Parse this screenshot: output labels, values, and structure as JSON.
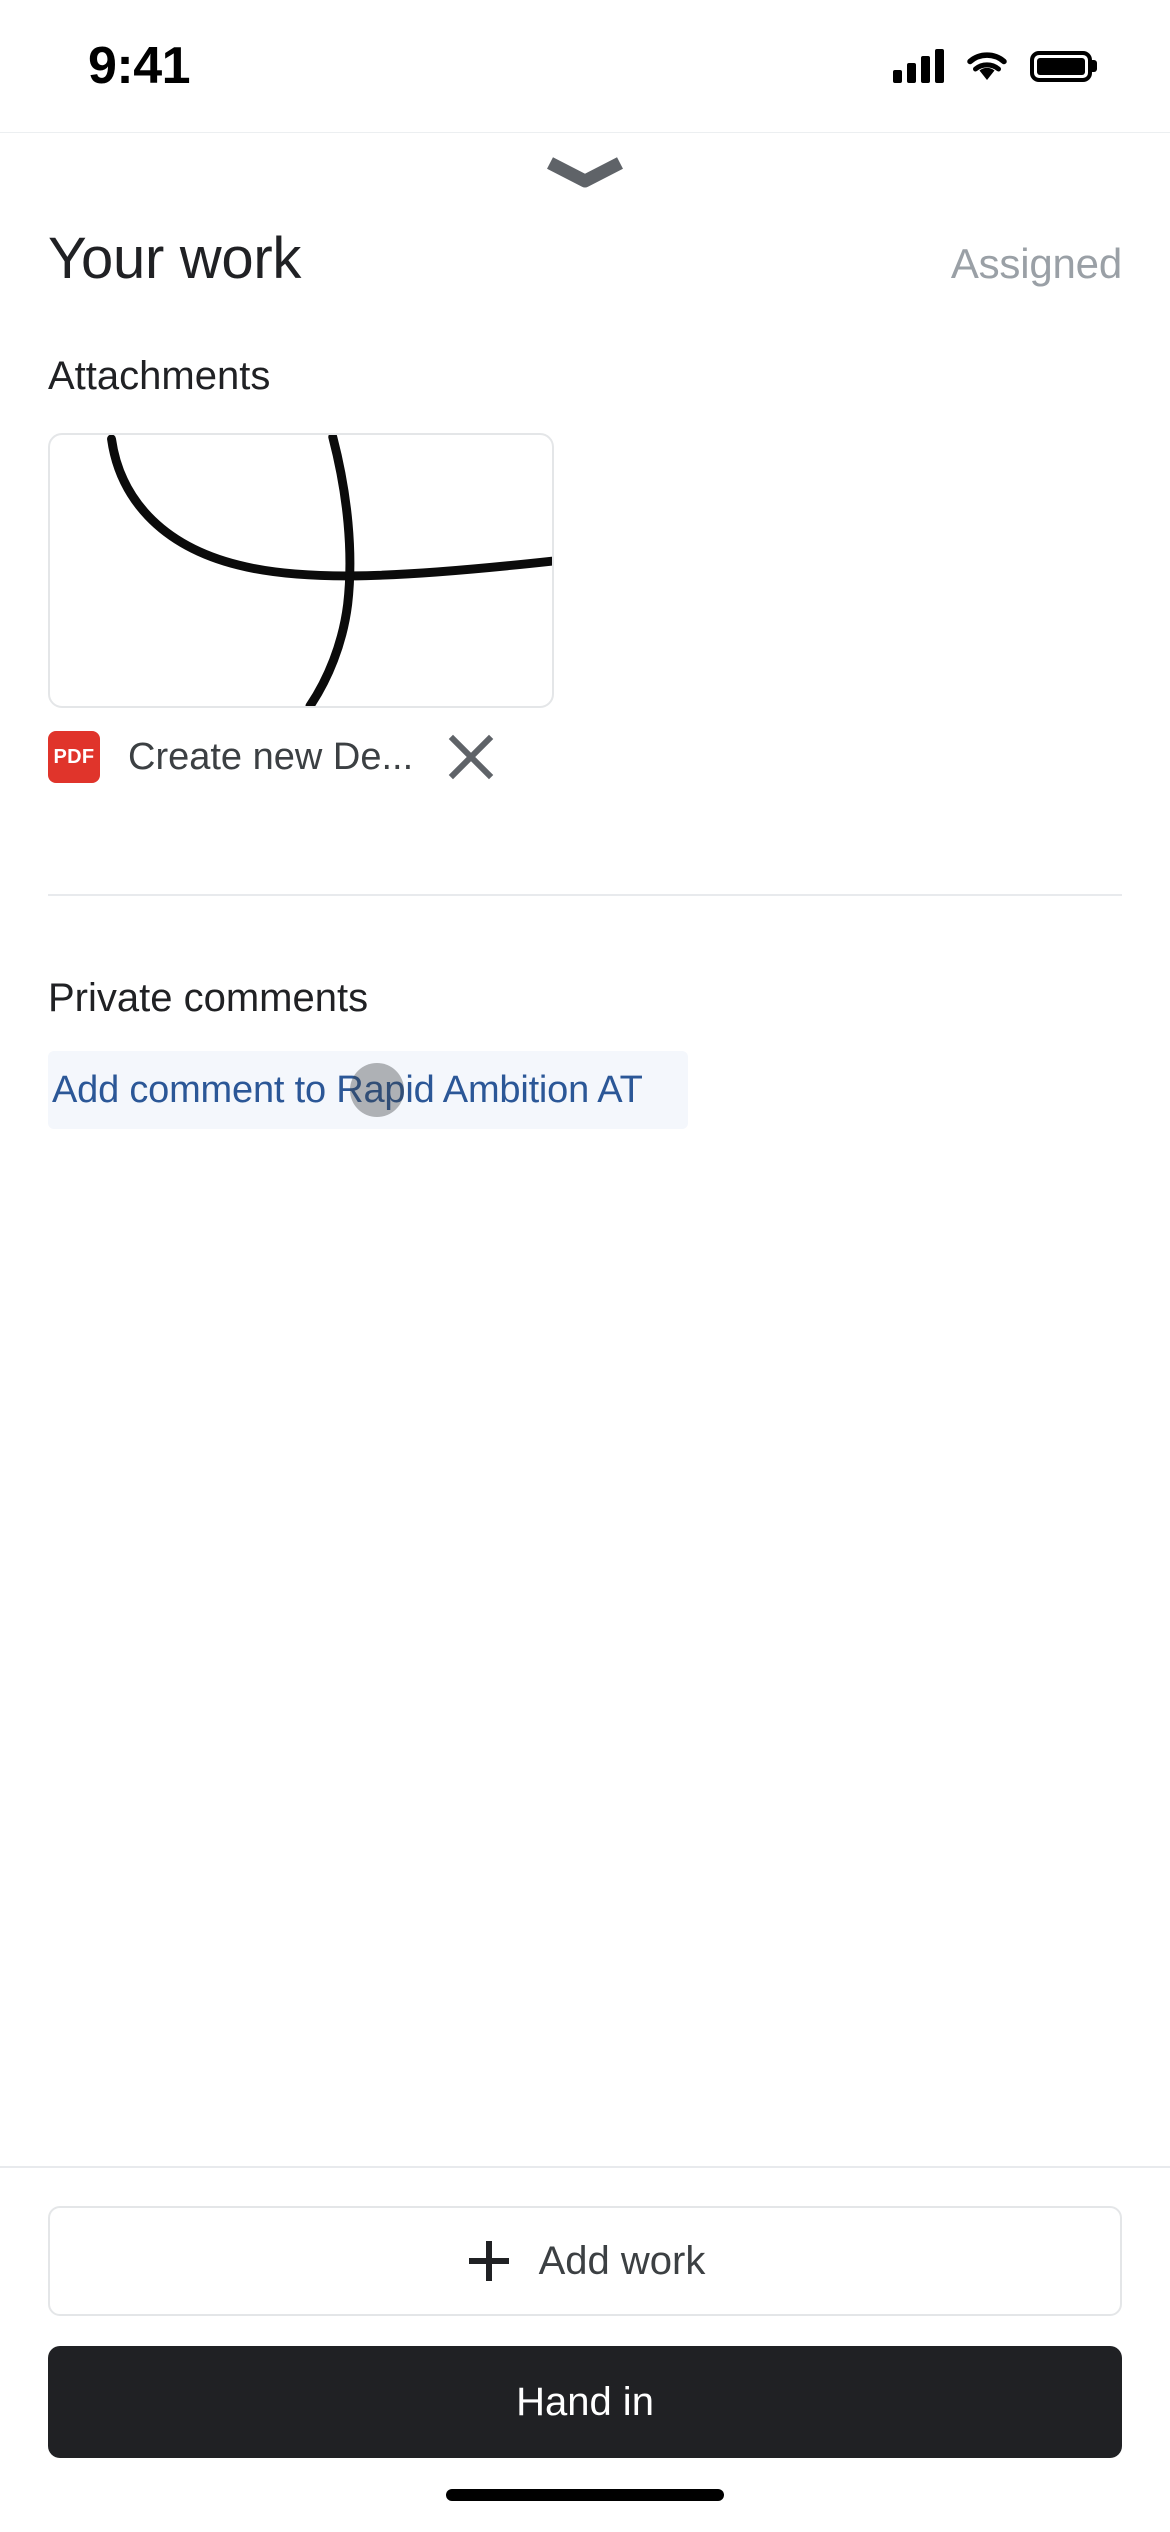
{
  "status_bar": {
    "time": "9:41",
    "signal_icon": "cellular-signal-icon",
    "wifi_icon": "wifi-icon",
    "battery_icon": "battery-full-icon"
  },
  "sheet": {
    "grabber_icon": "chevron-down-icon",
    "title": "Your work",
    "status": "Assigned"
  },
  "attachments": {
    "label": "Attachments",
    "items": [
      {
        "thumbnail_alt": "handwritten-sketch-thumbnail",
        "file_type_badge": "PDF",
        "file_name": "Create new De...",
        "remove_icon": "close-icon"
      }
    ]
  },
  "private_comments": {
    "label": "Private comments",
    "input_text": "Add comment to Rapid Ambition AT",
    "input_placeholder": "Add comment to Rapid Ambition AT",
    "touch_indicator": "touch-point-indicator"
  },
  "actions": {
    "add_work_icon": "plus-icon",
    "add_work_label": "Add work",
    "hand_in_label": "Hand in"
  },
  "colors": {
    "accent_blue": "#2b5797",
    "pdf_red": "#e0342b",
    "hand_in_dark": "#202124",
    "comment_field_bg": "#f4f7fc",
    "muted_gray": "#9aa0a6"
  }
}
